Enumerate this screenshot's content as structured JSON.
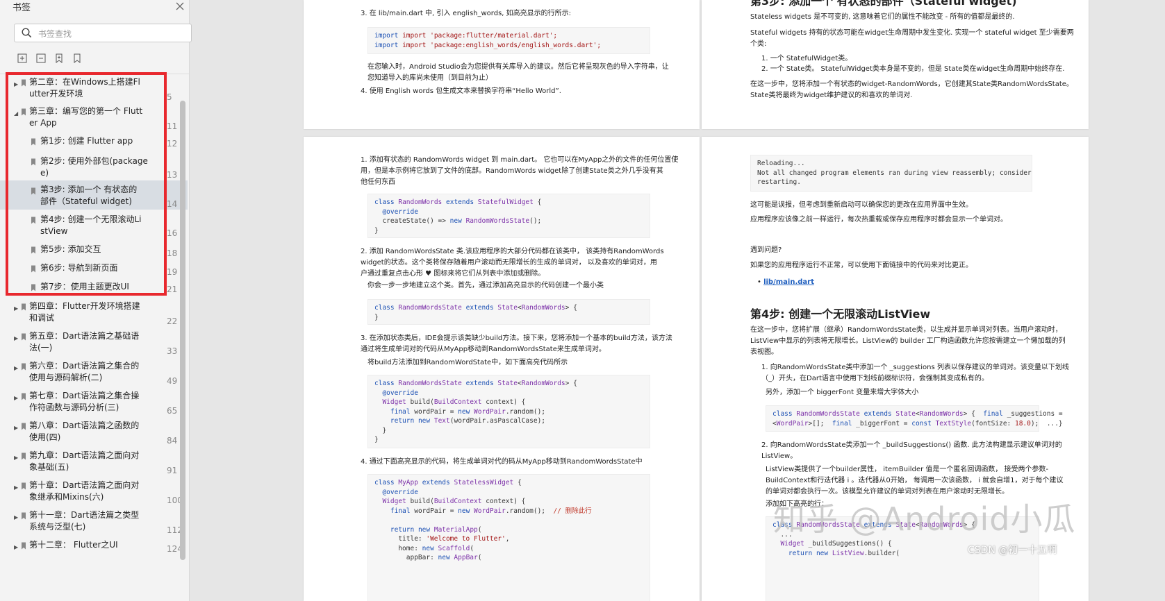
{
  "sidebar": {
    "title": "书签",
    "search_placeholder": "书签查找",
    "items": [
      {
        "label": "第二章：在Windows上搭建Fl\nutter开发环境",
        "page": "5"
      },
      {
        "label": "第三章：编写您的第一个 Flutt\ner App",
        "page": "11"
      },
      {
        "label": "第1步: 创建 Flutter app",
        "page": "12"
      },
      {
        "label": "第2步: 使用外部包(package\ne)",
        "page": "13"
      },
      {
        "label": "第3步: 添加一个 有状态的\n部件（Stateful widget)",
        "page": "14"
      },
      {
        "label": "第4步: 创建一个无限滚动Li\nstView",
        "page": "16"
      },
      {
        "label": "第5步: 添加交互",
        "page": "18"
      },
      {
        "label": "第6步: 导航到新页面",
        "page": "19"
      },
      {
        "label": "第7步：使用主题更改UI",
        "page": "21"
      },
      {
        "label": "第四章：Flutter开发环境搭建\n和调试",
        "page": "22"
      },
      {
        "label": "第五章：Dart语法篇之基础语\n法(一)",
        "page": "33"
      },
      {
        "label": "第六章：Dart语法篇之集合的\n使用与源码解析(二)",
        "page": "49"
      },
      {
        "label": "第七章：Dart语法篇之集合操\n作符函数与源码分析(三)",
        "page": "65"
      },
      {
        "label": "第八章：Dart语法篇之函数的\n使用(四)",
        "page": "84"
      },
      {
        "label": "第九章：Dart语法篇之面向对\n象基础(五)",
        "page": "91"
      },
      {
        "label": "第十章：Dart语法篇之面向对\n象继承和Mixins(六)",
        "page": "100"
      },
      {
        "label": "第十一章：Dart语法篇之类型\n系统与泛型(七)",
        "page": "112"
      },
      {
        "label": "第十二章： Flutter之UI",
        "page": "124"
      }
    ]
  },
  "doc": {
    "p1": {
      "step3": "3. 在 lib/main.dart 中, 引入 english_words, 如高亮显示的行所示:",
      "import1": "import 'package:flutter/material.dart';",
      "import2": "import 'package:english_words/english_words.dart';",
      "note": "在您输入时，Android Studio会为您提供有关库导入的建议。然后它将呈现灰色的导入字符串，让\n您知道导入的库尚未使用（到目前为止）",
      "step4": "4. 使用 English words 包生成文本来替换字符串“Hello World”."
    },
    "p2": {
      "heading": "第3步: 添加一个 有状态的部件（Stateful widget)",
      "stateless": "Stateless widgets 是不可变的, 这意味着它们的属性不能改变 - 所有的值都是最终的.",
      "stateful": "Stateful widgets 持有的状态可能在widget生命周期中发生变化. 实现一个 stateful widget 至少需要两\n个类:",
      "li1": "1. 一个 StatefulWidget类。",
      "li2": "2. 一个 State类。 StatefulWidget类本身是不变的，但是 State类在widget生命周期中始终存在.",
      "para": "在这一步中，您将添加一个有状态的widget-RandomWords，它创建其State类RandomWordsState。\nState类将最终为widget维护建议的和喜欢的单词对."
    },
    "p3": {
      "s1": "1. 添加有状态的 RandomWords widget 到 main.dart。 它也可以在MyApp之外的文件的任何位置使\n用，但是本示例将它放到了文件的底部。RandomWords widget除了创建State类之外几乎没有其\n他任何东西",
      "s2": "2. 添加 RandomWordsState 类.该应用程序的大部分代码都在该类中， 该类持有RandomWords\nwidget的状态。这个类将保存随着用户滚动而无限增长的生成的单词对， 以及喜欢的单词对，用\n户通过重复点击心形 ♥ 图标来将它们从列表中添加或删除。",
      "s2b": "你会一步一步地建立这个类。首先，通过添加高亮显示的代码创建一个最小类",
      "s3": "3. 在添加状态类后，IDE会提示该类缺少build方法。接下来，您将添加一个基本的build方法，该方法\n通过将生成单词对的代码从MyApp移动到RandomWordsState来生成单词对。",
      "s3b": "将build方法添加到RandomWordState中，如下面高亮代码所示",
      "s4": "4. 通过下面高亮显示的代码，将生成单词对代的码从MyApp移动到RandomWordsState中",
      "comment": "// 删除此行"
    },
    "p4": {
      "reload1": "Reloading...",
      "reload2": "Not all changed program elements ran during view reassembly; consider",
      "reload3": "restarting.",
      "t1": "这可能是误报，但考虑到重新启动可以确保您的更改在应用界面中生效。",
      "t2": "应用程序应该像之前一样运行，每次热重载或保存应用程序时都会显示一个单词对。",
      "t3": "遇到问题?",
      "t4": "如果您的应用程序运行不正常，可以使用下面链接中的代码来对比更正。",
      "link": "lib/main.dart",
      "heading": "第4步: 创建一个无限滚动ListView",
      "t5": "在这一步中，您将扩展（继承）RandomWordsState类，以生成并显示单词对列表。当用户滚动时，\nListView中显示的列表将无限增长。ListView的 builder 工厂构造函数允许您按需建立一个懒加载的列\n表视图。",
      "t6": "1. 向RandomWordsState类中添加一个 _suggestions 列表以保存建议的单词对。该变量以下划线\n（_）开头，在Dart语言中使用下划线前缀标识符，会强制其变成私有的。",
      "t7": "另外，添加一个 biggerFont 变量来增大字体大小",
      "t8": "2. 向RandomWordsState类添加一个 _buildSuggestions() 函数. 此方法构建显示建议单词对的\nListView。",
      "t9": "ListView类提供了一个builder属性， itemBuilder 值是一个匿名回调函数， 接受两个参数-\nBuildContext和行迭代器 i 。迭代器从0开始， 每调用一次该函数， i 就会自增1，对于每个建议\n的单词对都会执行一次。该模型允许建议的单词对列表在用户滚动时无限增长。",
      "t10": "添加如下高亮的行："
    }
  },
  "watermark": "知乎 @Android小瓜",
  "csdn_tag": "CSDN @初一十五啊"
}
